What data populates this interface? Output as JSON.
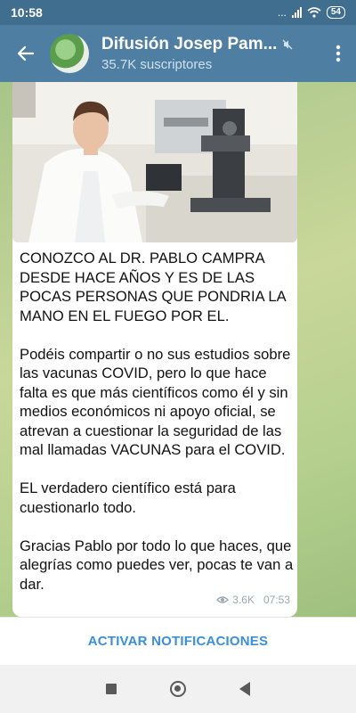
{
  "status_bar": {
    "time": "10:58",
    "network": "...",
    "battery": "54"
  },
  "header": {
    "title": "Difusión Josep Pam...",
    "subtitle": "35.7K suscriptores"
  },
  "message": {
    "paragraphs": [
      "CONOZCO AL DR. PABLO CAMPRA DESDE HACE AÑOS Y ES DE LAS POCAS PERSONAS QUE PONDRIA LA MANO EN EL FUEGO POR EL.",
      "Podéis compartir o no sus estudios sobre las vacunas COVID, pero lo que hace falta es que más científicos como él y sin medios económicos ni apoyo oficial, se atrevan a cuestionar la seguridad de las mal llamadas VACUNAS para el COVID.",
      "EL verdadero científico está para cuestionarlo todo.",
      "Gracias Pablo por todo lo que haces, que alegrías como puedes ver, pocas te van a dar."
    ],
    "views": "3.6K",
    "time": "07:53"
  },
  "footer": {
    "action_label": "ACTIVAR NOTIFICACIONES"
  },
  "colors": {
    "header": "#4f7ea3",
    "status_bar": "#3f6e8f",
    "accent": "#3a8fd6"
  },
  "icons": [
    "back-arrow-icon",
    "mute-icon",
    "more-vert-icon",
    "eye-icon",
    "wifi-icon",
    "signal-icon"
  ]
}
